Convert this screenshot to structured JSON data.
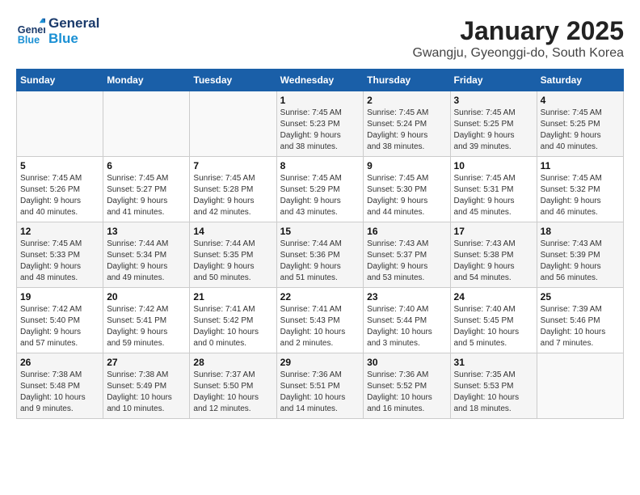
{
  "header": {
    "logo_line1": "General",
    "logo_line2": "Blue",
    "title": "January 2025",
    "subtitle": "Gwangju, Gyeonggi-do, South Korea"
  },
  "weekdays": [
    "Sunday",
    "Monday",
    "Tuesday",
    "Wednesday",
    "Thursday",
    "Friday",
    "Saturday"
  ],
  "weeks": [
    [
      {
        "day": "",
        "content": ""
      },
      {
        "day": "",
        "content": ""
      },
      {
        "day": "",
        "content": ""
      },
      {
        "day": "1",
        "content": "Sunrise: 7:45 AM\nSunset: 5:23 PM\nDaylight: 9 hours\nand 38 minutes."
      },
      {
        "day": "2",
        "content": "Sunrise: 7:45 AM\nSunset: 5:24 PM\nDaylight: 9 hours\nand 38 minutes."
      },
      {
        "day": "3",
        "content": "Sunrise: 7:45 AM\nSunset: 5:25 PM\nDaylight: 9 hours\nand 39 minutes."
      },
      {
        "day": "4",
        "content": "Sunrise: 7:45 AM\nSunset: 5:25 PM\nDaylight: 9 hours\nand 40 minutes."
      }
    ],
    [
      {
        "day": "5",
        "content": "Sunrise: 7:45 AM\nSunset: 5:26 PM\nDaylight: 9 hours\nand 40 minutes."
      },
      {
        "day": "6",
        "content": "Sunrise: 7:45 AM\nSunset: 5:27 PM\nDaylight: 9 hours\nand 41 minutes."
      },
      {
        "day": "7",
        "content": "Sunrise: 7:45 AM\nSunset: 5:28 PM\nDaylight: 9 hours\nand 42 minutes."
      },
      {
        "day": "8",
        "content": "Sunrise: 7:45 AM\nSunset: 5:29 PM\nDaylight: 9 hours\nand 43 minutes."
      },
      {
        "day": "9",
        "content": "Sunrise: 7:45 AM\nSunset: 5:30 PM\nDaylight: 9 hours\nand 44 minutes."
      },
      {
        "day": "10",
        "content": "Sunrise: 7:45 AM\nSunset: 5:31 PM\nDaylight: 9 hours\nand 45 minutes."
      },
      {
        "day": "11",
        "content": "Sunrise: 7:45 AM\nSunset: 5:32 PM\nDaylight: 9 hours\nand 46 minutes."
      }
    ],
    [
      {
        "day": "12",
        "content": "Sunrise: 7:45 AM\nSunset: 5:33 PM\nDaylight: 9 hours\nand 48 minutes."
      },
      {
        "day": "13",
        "content": "Sunrise: 7:44 AM\nSunset: 5:34 PM\nDaylight: 9 hours\nand 49 minutes."
      },
      {
        "day": "14",
        "content": "Sunrise: 7:44 AM\nSunset: 5:35 PM\nDaylight: 9 hours\nand 50 minutes."
      },
      {
        "day": "15",
        "content": "Sunrise: 7:44 AM\nSunset: 5:36 PM\nDaylight: 9 hours\nand 51 minutes."
      },
      {
        "day": "16",
        "content": "Sunrise: 7:43 AM\nSunset: 5:37 PM\nDaylight: 9 hours\nand 53 minutes."
      },
      {
        "day": "17",
        "content": "Sunrise: 7:43 AM\nSunset: 5:38 PM\nDaylight: 9 hours\nand 54 minutes."
      },
      {
        "day": "18",
        "content": "Sunrise: 7:43 AM\nSunset: 5:39 PM\nDaylight: 9 hours\nand 56 minutes."
      }
    ],
    [
      {
        "day": "19",
        "content": "Sunrise: 7:42 AM\nSunset: 5:40 PM\nDaylight: 9 hours\nand 57 minutes."
      },
      {
        "day": "20",
        "content": "Sunrise: 7:42 AM\nSunset: 5:41 PM\nDaylight: 9 hours\nand 59 minutes."
      },
      {
        "day": "21",
        "content": "Sunrise: 7:41 AM\nSunset: 5:42 PM\nDaylight: 10 hours\nand 0 minutes."
      },
      {
        "day": "22",
        "content": "Sunrise: 7:41 AM\nSunset: 5:43 PM\nDaylight: 10 hours\nand 2 minutes."
      },
      {
        "day": "23",
        "content": "Sunrise: 7:40 AM\nSunset: 5:44 PM\nDaylight: 10 hours\nand 3 minutes."
      },
      {
        "day": "24",
        "content": "Sunrise: 7:40 AM\nSunset: 5:45 PM\nDaylight: 10 hours\nand 5 minutes."
      },
      {
        "day": "25",
        "content": "Sunrise: 7:39 AM\nSunset: 5:46 PM\nDaylight: 10 hours\nand 7 minutes."
      }
    ],
    [
      {
        "day": "26",
        "content": "Sunrise: 7:38 AM\nSunset: 5:48 PM\nDaylight: 10 hours\nand 9 minutes."
      },
      {
        "day": "27",
        "content": "Sunrise: 7:38 AM\nSunset: 5:49 PM\nDaylight: 10 hours\nand 10 minutes."
      },
      {
        "day": "28",
        "content": "Sunrise: 7:37 AM\nSunset: 5:50 PM\nDaylight: 10 hours\nand 12 minutes."
      },
      {
        "day": "29",
        "content": "Sunrise: 7:36 AM\nSunset: 5:51 PM\nDaylight: 10 hours\nand 14 minutes."
      },
      {
        "day": "30",
        "content": "Sunrise: 7:36 AM\nSunset: 5:52 PM\nDaylight: 10 hours\nand 16 minutes."
      },
      {
        "day": "31",
        "content": "Sunrise: 7:35 AM\nSunset: 5:53 PM\nDaylight: 10 hours\nand 18 minutes."
      },
      {
        "day": "",
        "content": ""
      }
    ]
  ]
}
